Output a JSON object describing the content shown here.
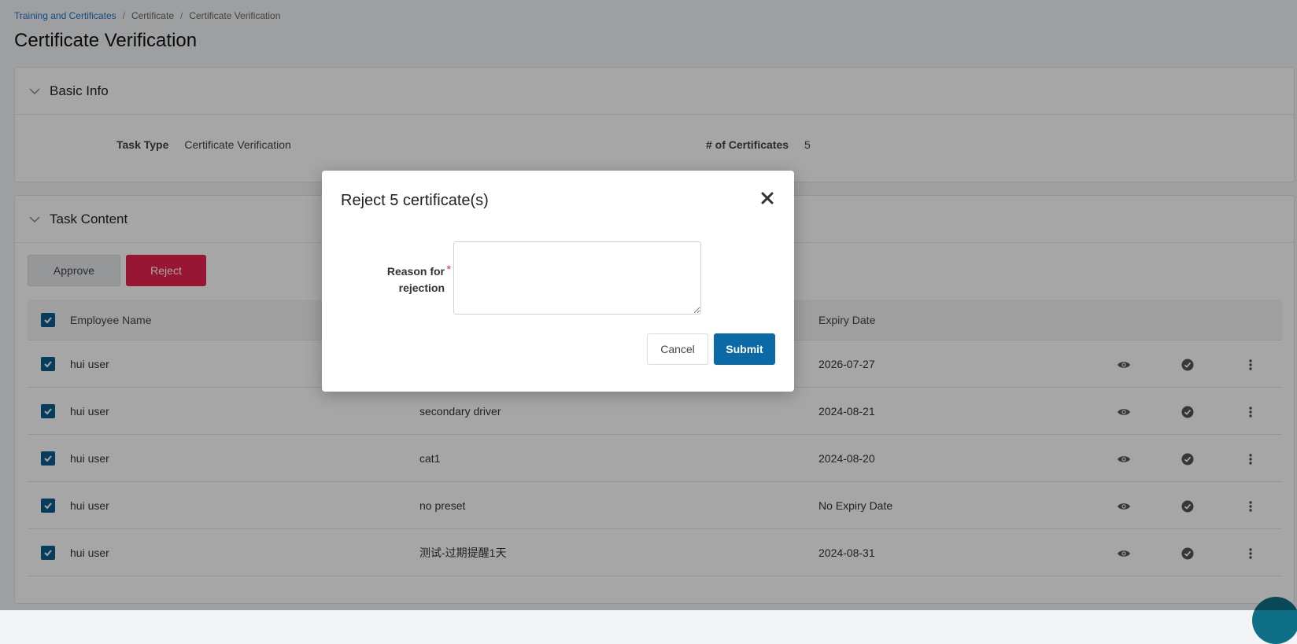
{
  "breadcrumb": {
    "items": [
      "Training and Certificates",
      "Certificate",
      "Certificate Verification"
    ],
    "separator": "/"
  },
  "page_title": "Certificate Verification",
  "basic_info": {
    "title": "Basic Info",
    "task_type_label": "Task Type",
    "task_type_value": "Certificate Verification",
    "cert_count_label": "# of Certificates",
    "cert_count_value": "5"
  },
  "task_content": {
    "title": "Task Content",
    "approve_label": "Approve",
    "reject_label": "Reject",
    "table": {
      "headers": {
        "employee_name": "Employee Name",
        "expiry_date": "Expiry Date"
      },
      "rows": [
        {
          "name": "hui user",
          "certificate": "",
          "expiry": "2026-07-27",
          "checked": true
        },
        {
          "name": "hui user",
          "certificate": "secondary driver",
          "expiry": "2024-08-21",
          "checked": true
        },
        {
          "name": "hui user",
          "certificate": "cat1",
          "expiry": "2024-08-20",
          "checked": true
        },
        {
          "name": "hui user",
          "certificate": "no preset",
          "expiry": "No Expiry Date",
          "checked": true
        },
        {
          "name": "hui user",
          "certificate": "测试-过期提醒1天",
          "expiry": "2024-08-31",
          "checked": true
        }
      ]
    }
  },
  "modal": {
    "title": "Reject 5 certificate(s)",
    "reason_label_line1": "Reason for",
    "reason_label_line2": "rejection",
    "required_mark": "*",
    "reason_value": "",
    "cancel_label": "Cancel",
    "submit_label": "Submit"
  },
  "icons": {
    "collapse": "chevron-down-icon",
    "view": "eye-icon",
    "approve_row": "check-circle-icon",
    "more": "more-vertical-icon",
    "close": "close-icon"
  },
  "colors": {
    "primary": "#0b6aa6",
    "danger": "#e8234f",
    "checkbox": "#0c5d8c",
    "link": "#1a73c8"
  }
}
